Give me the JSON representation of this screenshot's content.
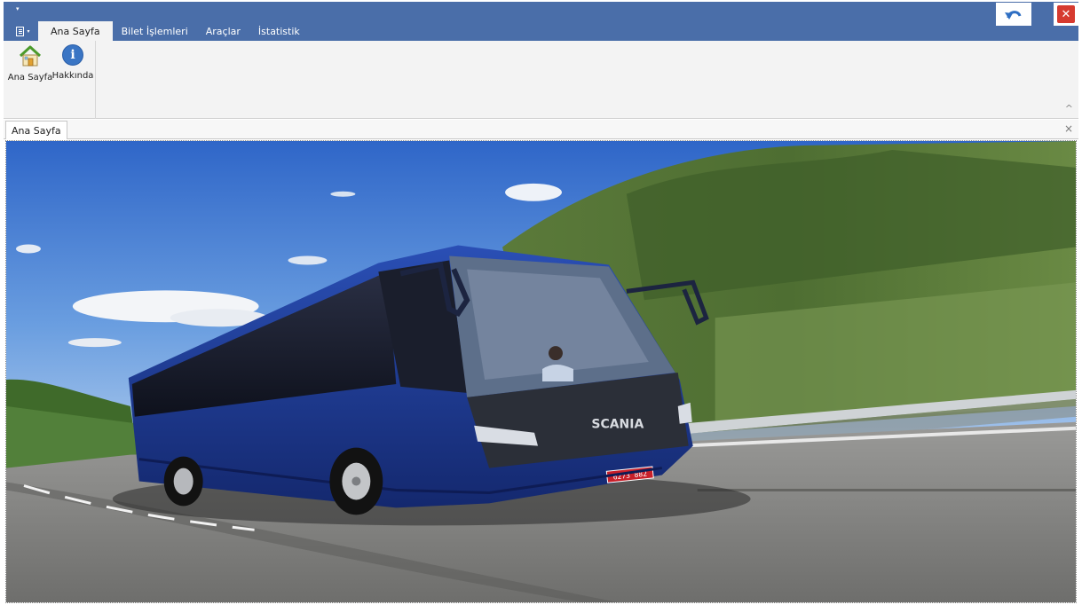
{
  "titlebar": {
    "quick_access_arrow": "▾",
    "app_menu_icon": "app-menu-icon",
    "undo_icon": "undo-icon",
    "close_icon": "close-icon",
    "close_glyph": "✕"
  },
  "ribbon_tabs": [
    {
      "label": "Ana Sayfa",
      "active": true
    },
    {
      "label": "Bilet İşlemleri",
      "active": false
    },
    {
      "label": "Araçlar",
      "active": false
    },
    {
      "label": "İstatistik",
      "active": false
    }
  ],
  "ribbon": {
    "buttons": [
      {
        "label": "Ana Sayfa",
        "icon": "home-icon"
      },
      {
        "label": "Hakkında",
        "icon": "info-icon"
      }
    ],
    "collapse_glyph": "^"
  },
  "document_tabs": {
    "active_label": "Ana Sayfa",
    "close_glyph": "×"
  },
  "content": {
    "image": "blue-coach-bus-on-highway",
    "bus_brand_text": "SCANIA",
    "license_plate": "6273 882"
  },
  "colors": {
    "title_bar": "#4a6ea9",
    "ribbon_bg": "#f3f3f3",
    "close_button": "#d63a2f",
    "undo_icon": "#2f6fc3",
    "bus_body": "#1d3b98"
  }
}
